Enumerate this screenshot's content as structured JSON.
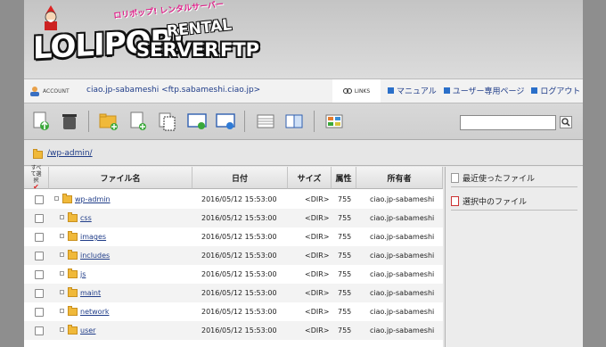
{
  "header": {
    "logo_main": "LOLIPOP!",
    "logo_rental": "RENTAL",
    "logo_server": "SERVER",
    "logo_ftp": "FTP",
    "logo_sub": "ロリポップ! レンタルサーバー"
  },
  "account": {
    "label": "ACCOUNT",
    "text": "ciao.jp-sabameshi <ftp.sabameshi.ciao.jp>"
  },
  "links": {
    "label": "LINKS",
    "items": [
      "マニュアル",
      "ユーザー専用ページ",
      "ログアウト"
    ]
  },
  "search": {
    "value": ""
  },
  "path": {
    "current": "/wp-admin/"
  },
  "table": {
    "headers": {
      "select_all": "すべて選択",
      "name": "ファイル名",
      "date": "日付",
      "size": "サイズ",
      "perm": "属性",
      "owner": "所有者"
    },
    "rows": [
      {
        "name": "wp-admin",
        "date": "2016/05/12 15:53:00",
        "size": "<DIR>",
        "perm": "755",
        "owner": "ciao.jp-sabameshi"
      },
      {
        "name": "css",
        "date": "2016/05/12 15:53:00",
        "size": "<DIR>",
        "perm": "755",
        "owner": "ciao.jp-sabameshi"
      },
      {
        "name": "images",
        "date": "2016/05/12 15:53:00",
        "size": "<DIR>",
        "perm": "755",
        "owner": "ciao.jp-sabameshi"
      },
      {
        "name": "includes",
        "date": "2016/05/12 15:53:00",
        "size": "<DIR>",
        "perm": "755",
        "owner": "ciao.jp-sabameshi"
      },
      {
        "name": "js",
        "date": "2016/05/12 15:53:00",
        "size": "<DIR>",
        "perm": "755",
        "owner": "ciao.jp-sabameshi"
      },
      {
        "name": "maint",
        "date": "2016/05/12 15:53:00",
        "size": "<DIR>",
        "perm": "755",
        "owner": "ciao.jp-sabameshi"
      },
      {
        "name": "network",
        "date": "2016/05/12 15:53:00",
        "size": "<DIR>",
        "perm": "755",
        "owner": "ciao.jp-sabameshi"
      },
      {
        "name": "user",
        "date": "2016/05/12 15:53:00",
        "size": "<DIR>",
        "perm": "755",
        "owner": "ciao.jp-sabameshi"
      }
    ]
  },
  "side": {
    "recent": "最近使ったファイル",
    "selected": "選択中のファイル"
  },
  "icons": {
    "upload": "upload-icon",
    "trash": "trash-icon",
    "new_folder": "new-folder-icon",
    "new_file": "new-file-icon",
    "copy": "copy-icon",
    "ftp_move": "move-icon",
    "web_view": "web-icon",
    "list_view": "list-view-icon",
    "detail_view": "detail-view-icon",
    "thumb_view": "thumbnail-view-icon",
    "search": "search-icon"
  }
}
